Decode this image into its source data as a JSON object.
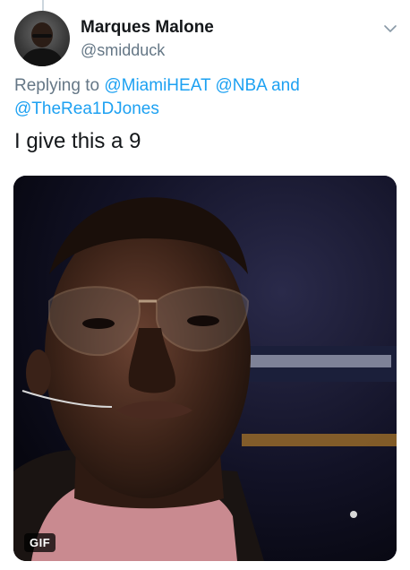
{
  "user": {
    "name": "Marques Malone",
    "handle": "@smidduck"
  },
  "reply": {
    "prefix": "Replying to",
    "mentions": [
      "@MiamiHEAT",
      "@NBA"
    ],
    "joiner": "and",
    "last_mention": "@TheRea1DJones"
  },
  "tweet": {
    "text": "I give this a 9"
  },
  "media": {
    "badge": "GIF"
  },
  "colors": {
    "link": "#1da1f2",
    "secondary_text": "#657786",
    "primary_text": "#14171a"
  },
  "icons": {
    "menu": "chevron-down-icon"
  }
}
